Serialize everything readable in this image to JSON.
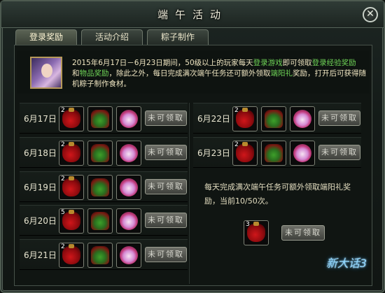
{
  "window": {
    "title": "端午活动"
  },
  "tabs": [
    {
      "label": "登录奖励",
      "active": true
    },
    {
      "label": "活动介绍",
      "active": false
    },
    {
      "label": "粽子制作",
      "active": false
    }
  ],
  "notice": {
    "line1_prefix": "2015年6月17日－6月23日期间，50级以上的玩家每天",
    "login_game": "登录游戏",
    "line1_mid": "即可领取",
    "login_exp": "登录经验奖励",
    "line2_and": "和",
    "item_reward": "物品奖励",
    "line2_mid": "，除此之外，每日完成满次端午任务还可额外领取",
    "duanyang": "端阳礼",
    "line2_suffix": "奖励，打开后可获得随机粽子制作食材。"
  },
  "rows_left": [
    {
      "date": "6月17日",
      "count": "2",
      "button": "未可领取"
    },
    {
      "date": "6月18日",
      "count": "2",
      "button": "未可领取"
    },
    {
      "date": "6月19日",
      "count": "2",
      "button": "未可领取"
    },
    {
      "date": "6月20日",
      "count": "5",
      "button": "未可领取"
    },
    {
      "date": "6月21日",
      "count": "2",
      "button": "未可领取"
    }
  ],
  "rows_right": [
    {
      "date": "6月22日",
      "count": "2",
      "button": "未可领取"
    },
    {
      "date": "6月23日",
      "count": "2",
      "button": "未可领取"
    }
  ],
  "bonus": {
    "text": "每天完成满次端午任务可额外领取端阳礼奖励，当前10/50次。",
    "count": "3",
    "button": "未可领取"
  },
  "logo_text": "新大话3",
  "close_icon": "close-icon"
}
